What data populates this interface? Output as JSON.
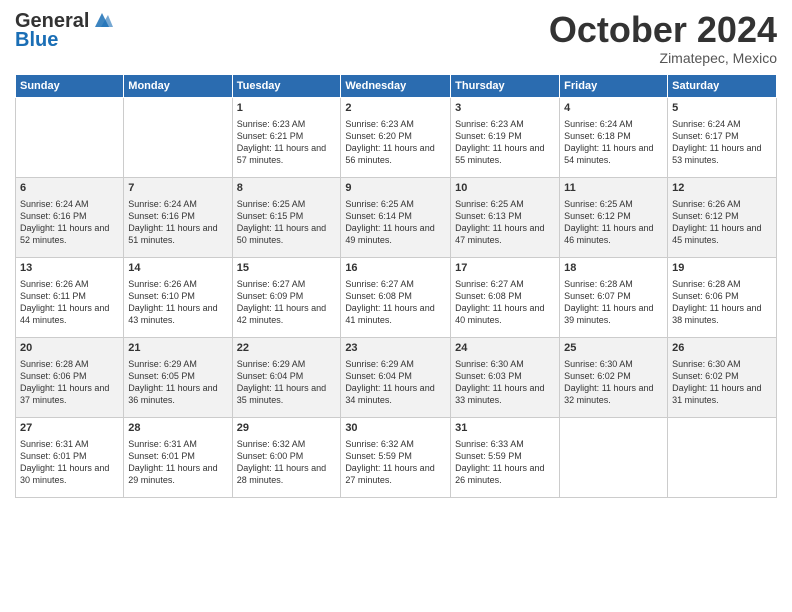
{
  "header": {
    "logo_line1": "General",
    "logo_line2": "Blue",
    "month": "October 2024",
    "location": "Zimatepec, Mexico"
  },
  "weekdays": [
    "Sunday",
    "Monday",
    "Tuesday",
    "Wednesday",
    "Thursday",
    "Friday",
    "Saturday"
  ],
  "weeks": [
    [
      {
        "day": "",
        "sunrise": "",
        "sunset": "",
        "daylight": ""
      },
      {
        "day": "",
        "sunrise": "",
        "sunset": "",
        "daylight": ""
      },
      {
        "day": "1",
        "sunrise": "Sunrise: 6:23 AM",
        "sunset": "Sunset: 6:21 PM",
        "daylight": "Daylight: 11 hours and 57 minutes."
      },
      {
        "day": "2",
        "sunrise": "Sunrise: 6:23 AM",
        "sunset": "Sunset: 6:20 PM",
        "daylight": "Daylight: 11 hours and 56 minutes."
      },
      {
        "day": "3",
        "sunrise": "Sunrise: 6:23 AM",
        "sunset": "Sunset: 6:19 PM",
        "daylight": "Daylight: 11 hours and 55 minutes."
      },
      {
        "day": "4",
        "sunrise": "Sunrise: 6:24 AM",
        "sunset": "Sunset: 6:18 PM",
        "daylight": "Daylight: 11 hours and 54 minutes."
      },
      {
        "day": "5",
        "sunrise": "Sunrise: 6:24 AM",
        "sunset": "Sunset: 6:17 PM",
        "daylight": "Daylight: 11 hours and 53 minutes."
      }
    ],
    [
      {
        "day": "6",
        "sunrise": "Sunrise: 6:24 AM",
        "sunset": "Sunset: 6:16 PM",
        "daylight": "Daylight: 11 hours and 52 minutes."
      },
      {
        "day": "7",
        "sunrise": "Sunrise: 6:24 AM",
        "sunset": "Sunset: 6:16 PM",
        "daylight": "Daylight: 11 hours and 51 minutes."
      },
      {
        "day": "8",
        "sunrise": "Sunrise: 6:25 AM",
        "sunset": "Sunset: 6:15 PM",
        "daylight": "Daylight: 11 hours and 50 minutes."
      },
      {
        "day": "9",
        "sunrise": "Sunrise: 6:25 AM",
        "sunset": "Sunset: 6:14 PM",
        "daylight": "Daylight: 11 hours and 49 minutes."
      },
      {
        "day": "10",
        "sunrise": "Sunrise: 6:25 AM",
        "sunset": "Sunset: 6:13 PM",
        "daylight": "Daylight: 11 hours and 47 minutes."
      },
      {
        "day": "11",
        "sunrise": "Sunrise: 6:25 AM",
        "sunset": "Sunset: 6:12 PM",
        "daylight": "Daylight: 11 hours and 46 minutes."
      },
      {
        "day": "12",
        "sunrise": "Sunrise: 6:26 AM",
        "sunset": "Sunset: 6:12 PM",
        "daylight": "Daylight: 11 hours and 45 minutes."
      }
    ],
    [
      {
        "day": "13",
        "sunrise": "Sunrise: 6:26 AM",
        "sunset": "Sunset: 6:11 PM",
        "daylight": "Daylight: 11 hours and 44 minutes."
      },
      {
        "day": "14",
        "sunrise": "Sunrise: 6:26 AM",
        "sunset": "Sunset: 6:10 PM",
        "daylight": "Daylight: 11 hours and 43 minutes."
      },
      {
        "day": "15",
        "sunrise": "Sunrise: 6:27 AM",
        "sunset": "Sunset: 6:09 PM",
        "daylight": "Daylight: 11 hours and 42 minutes."
      },
      {
        "day": "16",
        "sunrise": "Sunrise: 6:27 AM",
        "sunset": "Sunset: 6:08 PM",
        "daylight": "Daylight: 11 hours and 41 minutes."
      },
      {
        "day": "17",
        "sunrise": "Sunrise: 6:27 AM",
        "sunset": "Sunset: 6:08 PM",
        "daylight": "Daylight: 11 hours and 40 minutes."
      },
      {
        "day": "18",
        "sunrise": "Sunrise: 6:28 AM",
        "sunset": "Sunset: 6:07 PM",
        "daylight": "Daylight: 11 hours and 39 minutes."
      },
      {
        "day": "19",
        "sunrise": "Sunrise: 6:28 AM",
        "sunset": "Sunset: 6:06 PM",
        "daylight": "Daylight: 11 hours and 38 minutes."
      }
    ],
    [
      {
        "day": "20",
        "sunrise": "Sunrise: 6:28 AM",
        "sunset": "Sunset: 6:06 PM",
        "daylight": "Daylight: 11 hours and 37 minutes."
      },
      {
        "day": "21",
        "sunrise": "Sunrise: 6:29 AM",
        "sunset": "Sunset: 6:05 PM",
        "daylight": "Daylight: 11 hours and 36 minutes."
      },
      {
        "day": "22",
        "sunrise": "Sunrise: 6:29 AM",
        "sunset": "Sunset: 6:04 PM",
        "daylight": "Daylight: 11 hours and 35 minutes."
      },
      {
        "day": "23",
        "sunrise": "Sunrise: 6:29 AM",
        "sunset": "Sunset: 6:04 PM",
        "daylight": "Daylight: 11 hours and 34 minutes."
      },
      {
        "day": "24",
        "sunrise": "Sunrise: 6:30 AM",
        "sunset": "Sunset: 6:03 PM",
        "daylight": "Daylight: 11 hours and 33 minutes."
      },
      {
        "day": "25",
        "sunrise": "Sunrise: 6:30 AM",
        "sunset": "Sunset: 6:02 PM",
        "daylight": "Daylight: 11 hours and 32 minutes."
      },
      {
        "day": "26",
        "sunrise": "Sunrise: 6:30 AM",
        "sunset": "Sunset: 6:02 PM",
        "daylight": "Daylight: 11 hours and 31 minutes."
      }
    ],
    [
      {
        "day": "27",
        "sunrise": "Sunrise: 6:31 AM",
        "sunset": "Sunset: 6:01 PM",
        "daylight": "Daylight: 11 hours and 30 minutes."
      },
      {
        "day": "28",
        "sunrise": "Sunrise: 6:31 AM",
        "sunset": "Sunset: 6:01 PM",
        "daylight": "Daylight: 11 hours and 29 minutes."
      },
      {
        "day": "29",
        "sunrise": "Sunrise: 6:32 AM",
        "sunset": "Sunset: 6:00 PM",
        "daylight": "Daylight: 11 hours and 28 minutes."
      },
      {
        "day": "30",
        "sunrise": "Sunrise: 6:32 AM",
        "sunset": "Sunset: 5:59 PM",
        "daylight": "Daylight: 11 hours and 27 minutes."
      },
      {
        "day": "31",
        "sunrise": "Sunrise: 6:33 AM",
        "sunset": "Sunset: 5:59 PM",
        "daylight": "Daylight: 11 hours and 26 minutes."
      },
      {
        "day": "",
        "sunrise": "",
        "sunset": "",
        "daylight": ""
      },
      {
        "day": "",
        "sunrise": "",
        "sunset": "",
        "daylight": ""
      }
    ]
  ]
}
